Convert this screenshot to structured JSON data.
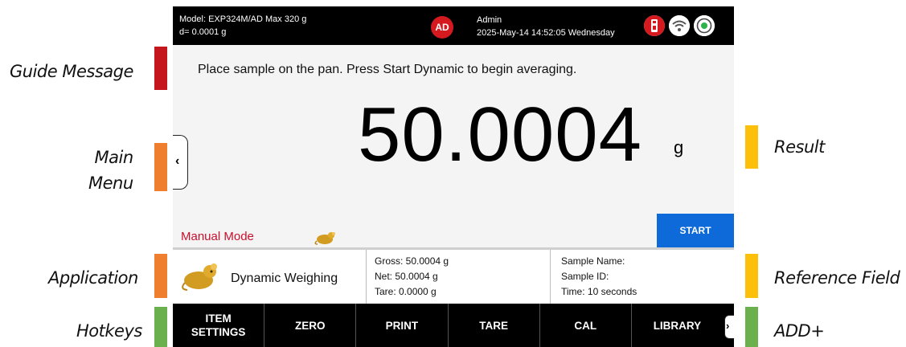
{
  "callouts": {
    "guide_message": "Guide Message",
    "main_menu_line1": "Main",
    "main_menu_line2": "Menu",
    "application": "Application",
    "hotkeys": "Hotkeys",
    "result": "Result",
    "reference_field": "Reference Field",
    "add_plus": "ADD+"
  },
  "colors": {
    "marker_red": "#c4161c",
    "marker_orange": "#ef7e2e",
    "marker_green": "#6ab04c",
    "marker_yellow": "#fcbf0a",
    "start_blue": "#0d6ad8",
    "mode_red": "#c8102e",
    "avatar_red": "#d41a1f"
  },
  "topbar": {
    "model": "Model: EXP324M/AD   Max 320 g",
    "readability": "d= 0.0001 g",
    "avatar_initials": "AD",
    "user_name": "Admin",
    "datetime": "2025-May-14 14:52:05 Wednesday",
    "icons": [
      "usb-icon",
      "wifi-icon",
      "level-icon"
    ]
  },
  "guide": {
    "message": "Place sample on the pan.  Press Start Dynamic to begin averaging."
  },
  "result": {
    "value": "50.0004",
    "unit": "g"
  },
  "mode": {
    "label": "Manual Mode",
    "icon": "mouse-icon"
  },
  "start_button": {
    "label": "START"
  },
  "application": {
    "name": "Dynamic Weighing",
    "icon": "mouse-icon"
  },
  "weights": {
    "gross": "Gross: 50.0004 g",
    "net": "Net: 50.0004 g",
    "tare": "Tare: 0.0000 g"
  },
  "reference": {
    "sample_name": "Sample Name:",
    "sample_id": "Sample ID:",
    "time": "Time: 10 seconds"
  },
  "hotkeys": {
    "item_settings_1": "ITEM",
    "item_settings_2": "SETTINGS",
    "zero": "ZERO",
    "print": "PRINT",
    "tare": "TARE",
    "cal": "CAL",
    "library": "LIBRARY"
  }
}
